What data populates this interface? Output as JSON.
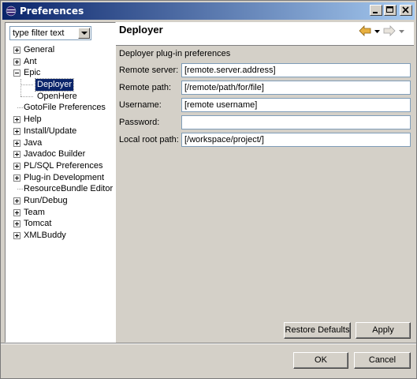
{
  "window": {
    "title": "Preferences"
  },
  "filter": {
    "value": "type filter text"
  },
  "tree": [
    {
      "label": "General",
      "expander": "plus",
      "level": 0
    },
    {
      "label": "Ant",
      "expander": "plus",
      "level": 0
    },
    {
      "label": "Epic",
      "expander": "minus",
      "level": 0
    },
    {
      "label": "Deployer",
      "expander": "none",
      "level": 1,
      "selected": true
    },
    {
      "label": "OpenHere",
      "expander": "none",
      "level": 1
    },
    {
      "label": "GotoFile Preferences",
      "expander": "none",
      "level": 0
    },
    {
      "label": "Help",
      "expander": "plus",
      "level": 0
    },
    {
      "label": "Install/Update",
      "expander": "plus",
      "level": 0
    },
    {
      "label": "Java",
      "expander": "plus",
      "level": 0
    },
    {
      "label": "Javadoc Builder",
      "expander": "plus",
      "level": 0
    },
    {
      "label": "PL/SQL Preferences",
      "expander": "plus",
      "level": 0
    },
    {
      "label": "Plug-in Development",
      "expander": "plus",
      "level": 0
    },
    {
      "label": "ResourceBundle Editor",
      "expander": "none",
      "level": 0
    },
    {
      "label": "Run/Debug",
      "expander": "plus",
      "level": 0
    },
    {
      "label": "Team",
      "expander": "plus",
      "level": 0
    },
    {
      "label": "Tomcat",
      "expander": "plus",
      "level": 0
    },
    {
      "label": "XMLBuddy",
      "expander": "plus",
      "level": 0
    }
  ],
  "page": {
    "title": "Deployer",
    "description": "Deployer plug-in preferences",
    "fields": [
      {
        "label": "Remote server:",
        "value": "[remote.server.address]"
      },
      {
        "label": "Remote path:",
        "value": "[/remote/path/for/file]"
      },
      {
        "label": "Username:",
        "value": "[remote username]"
      },
      {
        "label": "Password:",
        "value": ""
      },
      {
        "label": "Local root path:",
        "value": "[/workspace/project/]"
      }
    ],
    "restore_defaults": "Restore Defaults",
    "apply": "Apply"
  },
  "footer": {
    "ok": "OK",
    "cancel": "Cancel"
  },
  "colors": {
    "titlebar_start": "#0a246a",
    "titlebar_end": "#a6caf0",
    "selection": "#0a246a",
    "chrome": "#d4d0c8",
    "arrow_back": "#e8b040"
  }
}
